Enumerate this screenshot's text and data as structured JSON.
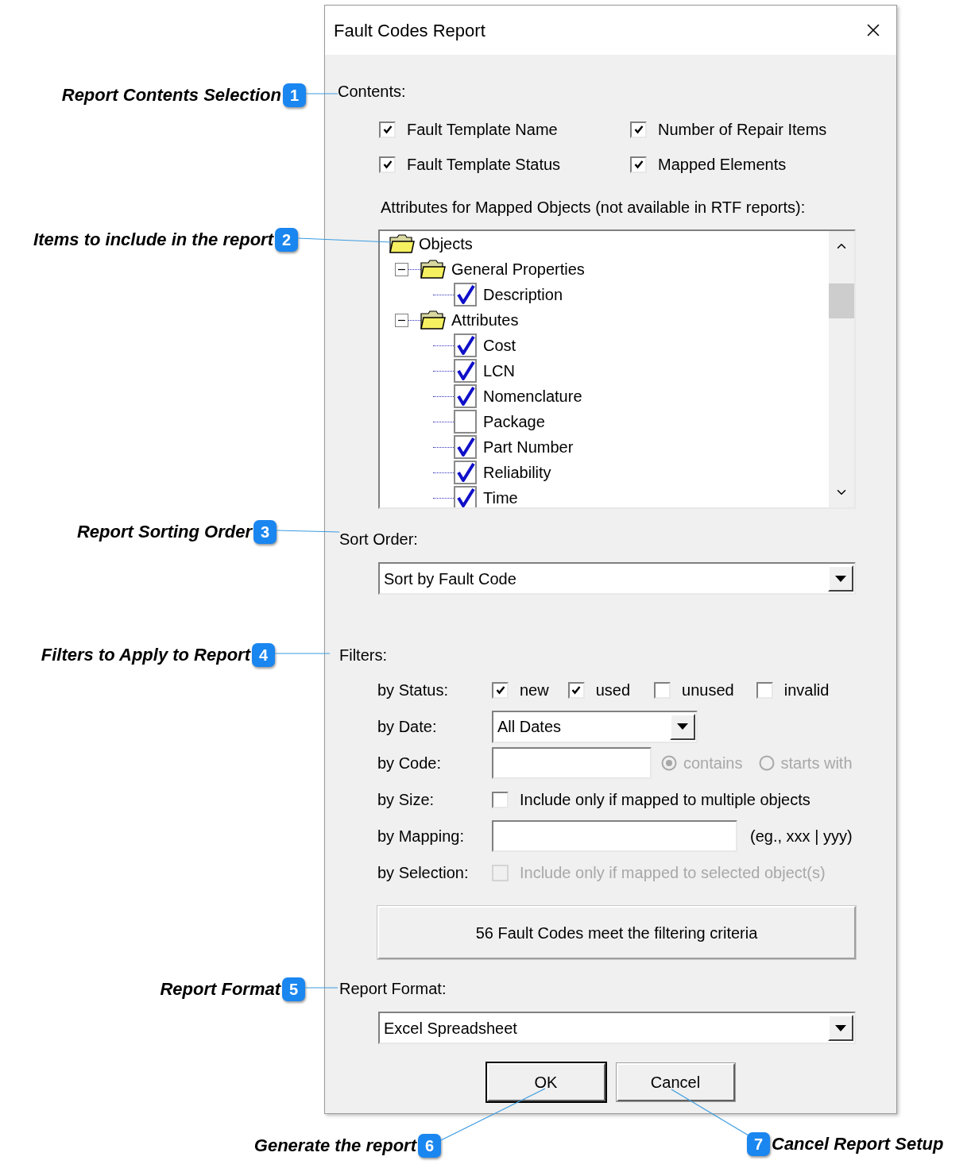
{
  "dialog": {
    "title": "Fault Codes Report",
    "contents": {
      "label": "Contents:",
      "options": [
        {
          "label": "Fault Template Name",
          "checked": true
        },
        {
          "label": "Number of Repair Items",
          "checked": true
        },
        {
          "label": "Fault Template Status",
          "checked": true
        },
        {
          "label": "Mapped Elements",
          "checked": true
        }
      ]
    },
    "attributes_label": "Attributes for Mapped Objects (not available in RTF reports):",
    "tree": {
      "items": [
        {
          "label": "Objects",
          "kind": "folder",
          "children": [
            {
              "label": "General Properties",
              "kind": "folder",
              "expanded": true,
              "children": [
                {
                  "label": "Description",
                  "kind": "check",
                  "checked": true
                }
              ]
            },
            {
              "label": "Attributes",
              "kind": "folder",
              "expanded": true,
              "children": [
                {
                  "label": "Cost",
                  "kind": "check",
                  "checked": true
                },
                {
                  "label": "LCN",
                  "kind": "check",
                  "checked": true
                },
                {
                  "label": "Nomenclature",
                  "kind": "check",
                  "checked": true
                },
                {
                  "label": "Package",
                  "kind": "check",
                  "checked": false
                },
                {
                  "label": "Part Number",
                  "kind": "check",
                  "checked": true
                },
                {
                  "label": "Reliability",
                  "kind": "check",
                  "checked": true
                },
                {
                  "label": "Time",
                  "kind": "check",
                  "checked": true
                }
              ]
            }
          ]
        }
      ]
    },
    "sort": {
      "label": "Sort Order:",
      "value": "Sort by Fault Code"
    },
    "filters": {
      "label": "Filters:",
      "rows": [
        {
          "kind": "checkboxes",
          "label": "by Status:",
          "options": [
            {
              "label": "new",
              "checked": true
            },
            {
              "label": "used",
              "checked": true
            },
            {
              "label": "unused",
              "checked": false
            },
            {
              "label": "invalid",
              "checked": false
            }
          ]
        },
        {
          "kind": "dropdown",
          "label": "by Date:",
          "value": "All Dates"
        },
        {
          "kind": "text_radio",
          "label": "by Code:",
          "options": [
            {
              "label": "contains",
              "selected": true,
              "disabled": true
            },
            {
              "label": "starts with",
              "selected": false,
              "disabled": true
            }
          ]
        },
        {
          "kind": "checkbox",
          "label": "by Size:",
          "option": {
            "label": "Include only if mapped to multiple objects",
            "checked": false,
            "disabled": false
          }
        },
        {
          "kind": "text_hint",
          "label": "by Mapping:",
          "hint": "(eg., xxx | yyy)"
        },
        {
          "kind": "checkbox",
          "label": "by Selection:",
          "option": {
            "label": "Include only if mapped to selected object(s)",
            "checked": false,
            "disabled": true
          }
        }
      ]
    },
    "status": "56 Fault Codes meet the filtering criteria",
    "format": {
      "label": "Report Format:",
      "value": "Excel Spreadsheet"
    },
    "buttons": [
      {
        "label": "OK",
        "default": true
      },
      {
        "label": "Cancel",
        "default": false
      }
    ]
  },
  "callouts": [
    {
      "number": "1",
      "text": "Report Contents Selection"
    },
    {
      "number": "2",
      "text": "Items to include in the report"
    },
    {
      "number": "3",
      "text": "Report Sorting Order"
    },
    {
      "number": "4",
      "text": "Filters to Apply to Report"
    },
    {
      "number": "5",
      "text": "Report Format"
    },
    {
      "number": "6",
      "text": "Generate the report"
    },
    {
      "number": "7",
      "text": "Cancel Report Setup"
    }
  ]
}
